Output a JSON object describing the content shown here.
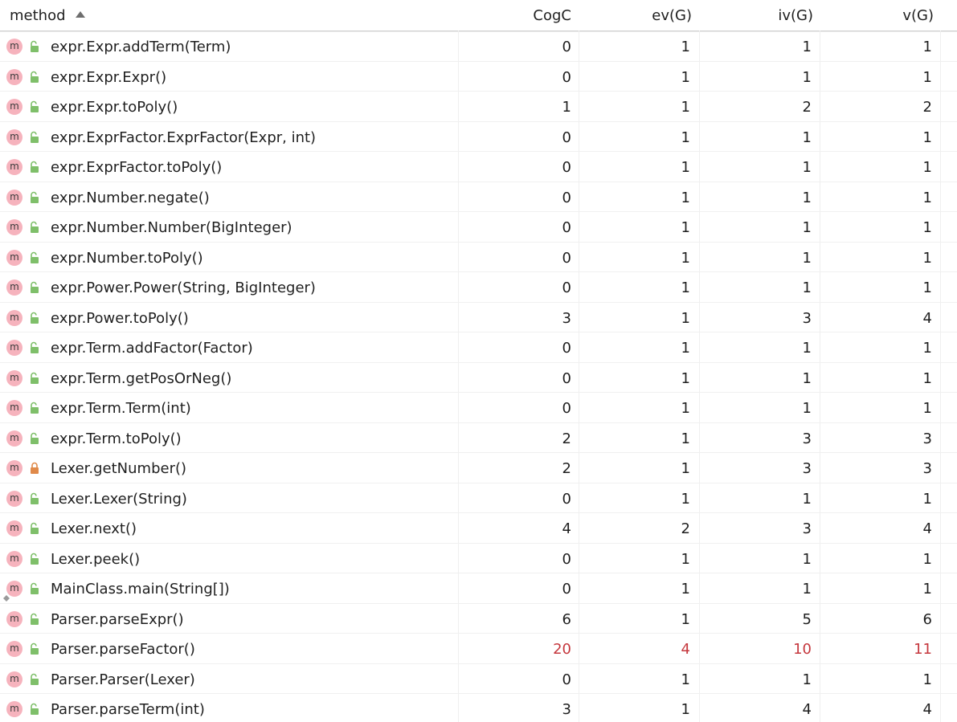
{
  "columns": {
    "method": "method",
    "cogc": "CogC",
    "evg": "ev(G)",
    "ivg": "iv(G)",
    "vg": "v(G)"
  },
  "colors": {
    "method_icon_bg": "#f6b3bd",
    "public_lock": "#7fbf6a",
    "private_lock": "#e08a4a",
    "highlight_value": "#c5373d"
  },
  "rows": [
    {
      "method": "expr.Expr.addTerm(Term)",
      "cogc": "0",
      "evg": "1",
      "ivg": "1",
      "vg": "1",
      "access": "public"
    },
    {
      "method": "expr.Expr.Expr()",
      "cogc": "0",
      "evg": "1",
      "ivg": "1",
      "vg": "1",
      "access": "public"
    },
    {
      "method": "expr.Expr.toPoly()",
      "cogc": "1",
      "evg": "1",
      "ivg": "2",
      "vg": "2",
      "access": "public"
    },
    {
      "method": "expr.ExprFactor.ExprFactor(Expr, int)",
      "cogc": "0",
      "evg": "1",
      "ivg": "1",
      "vg": "1",
      "access": "public"
    },
    {
      "method": "expr.ExprFactor.toPoly()",
      "cogc": "0",
      "evg": "1",
      "ivg": "1",
      "vg": "1",
      "access": "public"
    },
    {
      "method": "expr.Number.negate()",
      "cogc": "0",
      "evg": "1",
      "ivg": "1",
      "vg": "1",
      "access": "public"
    },
    {
      "method": "expr.Number.Number(BigInteger)",
      "cogc": "0",
      "evg": "1",
      "ivg": "1",
      "vg": "1",
      "access": "public"
    },
    {
      "method": "expr.Number.toPoly()",
      "cogc": "0",
      "evg": "1",
      "ivg": "1",
      "vg": "1",
      "access": "public"
    },
    {
      "method": "expr.Power.Power(String, BigInteger)",
      "cogc": "0",
      "evg": "1",
      "ivg": "1",
      "vg": "1",
      "access": "public"
    },
    {
      "method": "expr.Power.toPoly()",
      "cogc": "3",
      "evg": "1",
      "ivg": "3",
      "vg": "4",
      "access": "public"
    },
    {
      "method": "expr.Term.addFactor(Factor)",
      "cogc": "0",
      "evg": "1",
      "ivg": "1",
      "vg": "1",
      "access": "public"
    },
    {
      "method": "expr.Term.getPosOrNeg()",
      "cogc": "0",
      "evg": "1",
      "ivg": "1",
      "vg": "1",
      "access": "public"
    },
    {
      "method": "expr.Term.Term(int)",
      "cogc": "0",
      "evg": "1",
      "ivg": "1",
      "vg": "1",
      "access": "public"
    },
    {
      "method": "expr.Term.toPoly()",
      "cogc": "2",
      "evg": "1",
      "ivg": "3",
      "vg": "3",
      "access": "public"
    },
    {
      "method": "Lexer.getNumber()",
      "cogc": "2",
      "evg": "1",
      "ivg": "3",
      "vg": "3",
      "access": "private"
    },
    {
      "method": "Lexer.Lexer(String)",
      "cogc": "0",
      "evg": "1",
      "ivg": "1",
      "vg": "1",
      "access": "public"
    },
    {
      "method": "Lexer.next()",
      "cogc": "4",
      "evg": "2",
      "ivg": "3",
      "vg": "4",
      "access": "public"
    },
    {
      "method": "Lexer.peek()",
      "cogc": "0",
      "evg": "1",
      "ivg": "1",
      "vg": "1",
      "access": "public"
    },
    {
      "method": "MainClass.main(String[])",
      "cogc": "0",
      "evg": "1",
      "ivg": "1",
      "vg": "1",
      "access": "public",
      "entry": true
    },
    {
      "method": "Parser.parseExpr()",
      "cogc": "6",
      "evg": "1",
      "ivg": "5",
      "vg": "6",
      "access": "public"
    },
    {
      "method": "Parser.parseFactor()",
      "cogc": "20",
      "evg": "4",
      "ivg": "10",
      "vg": "11",
      "access": "public",
      "highlight": true
    },
    {
      "method": "Parser.Parser(Lexer)",
      "cogc": "0",
      "evg": "1",
      "ivg": "1",
      "vg": "1",
      "access": "public"
    },
    {
      "method": "Parser.parseTerm(int)",
      "cogc": "3",
      "evg": "1",
      "ivg": "4",
      "vg": "4",
      "access": "public"
    }
  ]
}
